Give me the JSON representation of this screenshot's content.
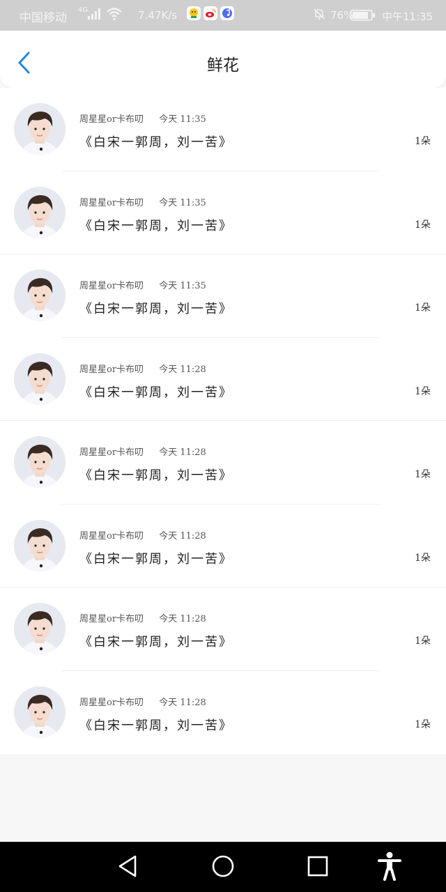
{
  "status_bar": {
    "carrier": "中国移动",
    "network": "4G",
    "speed": "7.47K/s",
    "battery_percent": "76%",
    "time": "中午11:35"
  },
  "nav": {
    "title": "鲜花",
    "back_icon": "chevron-left-icon",
    "accent_color": "#1e88e5"
  },
  "list": [
    {
      "name": "周星星or卡布叨",
      "date": "今天",
      "time": "11:35",
      "message": "《白宋一郭周，刘一苦》",
      "count": "1朵"
    },
    {
      "name": "周星星or卡布叨",
      "date": "今天",
      "time": "11:35",
      "message": "《白宋一郭周，刘一苦》",
      "count": "1朵"
    },
    {
      "name": "周星星or卡布叨",
      "date": "今天",
      "time": "11:35",
      "message": "《白宋一郭周，刘一苦》",
      "count": "1朵"
    },
    {
      "name": "周星星or卡布叨",
      "date": "今天",
      "time": "11:28",
      "message": "《白宋一郭周，刘一苦》",
      "count": "1朵"
    },
    {
      "name": "周星星or卡布叨",
      "date": "今天",
      "time": "11:28",
      "message": "《白宋一郭周，刘一苦》",
      "count": "1朵"
    },
    {
      "name": "周星星or卡布叨",
      "date": "今天",
      "time": "11:28",
      "message": "《白宋一郭周，刘一苦》",
      "count": "1朵"
    },
    {
      "name": "周星星or卡布叨",
      "date": "今天",
      "time": "11:28",
      "message": "《白宋一郭周，刘一苦》",
      "count": "1朵"
    },
    {
      "name": "周星星or卡布叨",
      "date": "今天",
      "time": "11:28",
      "message": "《白宋一郭周，刘一苦》",
      "count": "1朵"
    }
  ],
  "android_nav": {
    "buttons": [
      "back-triangle-icon",
      "home-circle-icon",
      "recents-square-icon",
      "accessibility-icon"
    ]
  }
}
